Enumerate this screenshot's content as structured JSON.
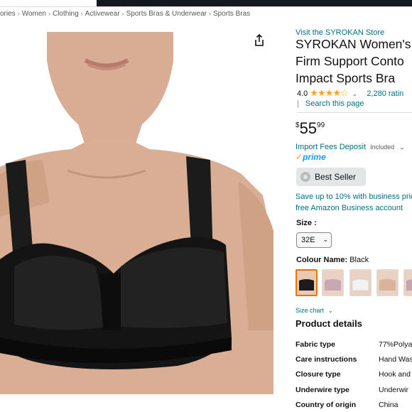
{
  "breadcrumb": [
    "ories",
    "Women",
    "Clothing",
    "Activewear",
    "Sports Bras & Underwear",
    "Sports Bras"
  ],
  "breadcrumb_separator": "›",
  "store_link": "Visit the SYROKAN Store",
  "title_lines": [
    "SYROKAN Women's",
    "Firm Support Conto",
    "Impact Sports Bra"
  ],
  "rating": {
    "value": "4.0",
    "stars": 4.0,
    "chevron": "⌄",
    "count": "2,280 ratin"
  },
  "search_page": "Search this page",
  "price": {
    "currency": "$",
    "whole": "55",
    "fraction": "99"
  },
  "import_fees": {
    "link": "Import Fees Deposit",
    "included": "Included",
    "chevron": "⌄"
  },
  "prime": {
    "check": "✓",
    "label": "prime"
  },
  "best_seller": "Best Seller",
  "business": {
    "line1": "Save up to 10% with business pric",
    "line2": "free Amazon Business account"
  },
  "size": {
    "label": "Size :",
    "selected": "32E"
  },
  "colour": {
    "label": "Colour Name:",
    "value": "Black",
    "swatch_colors": [
      "#1c1c1c",
      "#c9a8b6",
      "#e8e8ee",
      "#d9b39a",
      "#c7a3b5"
    ]
  },
  "size_chart": "Size chart",
  "size_chart_chevron": "⌄",
  "product_details": {
    "heading": "Product details",
    "rows": [
      {
        "key": "Fabric type",
        "value": "77%Polya"
      },
      {
        "key": "Care instructions",
        "value": "Hand Was"
      },
      {
        "key": "Closure type",
        "value": "Hook and"
      },
      {
        "key": "Underwire type",
        "value": "Underwir"
      },
      {
        "key": "Country of origin",
        "value": "China"
      }
    ]
  },
  "icons": {
    "share": "share-icon",
    "best_seller": "best-seller-badge-icon",
    "dropdown": "chevron-down-icon"
  },
  "colors": {
    "link": "#007185",
    "star": "#ffa41c",
    "prime": "#1a98ff",
    "selected_swatch": "#e77600",
    "header": "#131921"
  }
}
